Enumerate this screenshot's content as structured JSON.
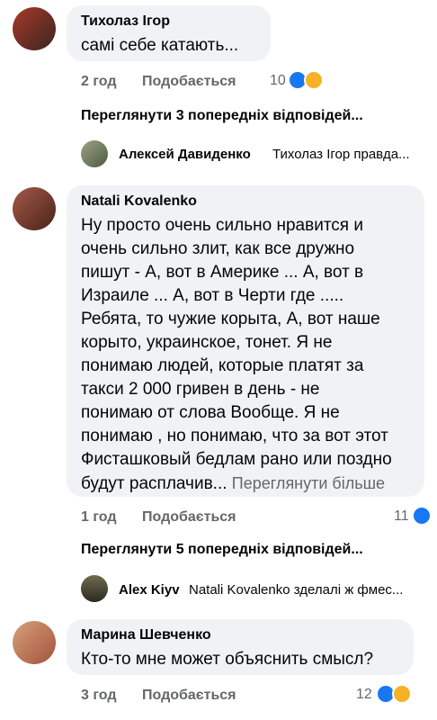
{
  "comments": [
    {
      "author": "Тихолаз Ігор",
      "text": "самі себе катають...",
      "time": "2 год",
      "like_label": "Подобається",
      "reactions": "10"
    },
    {
      "author": "Natali Kovalenko",
      "lines": [
        "Ну просто очень сильно нравится и",
        "очень сильно злит, как все дружно",
        "пишут - А, вот в Америке ... А, вот в",
        "Израиле  ...  А, вот в  Черти где .....",
        "Ребята, то чужие корыта, А, вот наше",
        "корыто, украинское, тонет. Я не",
        "понимаю людей, которые платят за",
        "такси 2 000 гривен в день - не",
        "понимаю от слова Вообще. Я не",
        "понимаю , но понимаю, что за вот этот",
        "Фисташковый бедлам рано или поздно"
      ],
      "last_line": "будут расплачив...",
      "see_more": "Переглянути більше",
      "time": "1 год",
      "like_label": "Подобається",
      "reactions": "11"
    },
    {
      "author": "Марина Шевченко",
      "text": "Кто-то мне может объяснить смысл?",
      "time": "3 год",
      "like_label": "Подобається",
      "reactions": "12"
    }
  ],
  "replies_threads": [
    {
      "view_prev": "Переглянути 3 попередніх відповідей...",
      "reply_author": "Алексей Давиденко",
      "reply_text": "Тихолаз Ігор правда..."
    },
    {
      "view_prev": "Переглянути 5 попередніх відповідей...",
      "reply_author": "Alex Kiyv",
      "reply_text": "Natali Kovalenko зделалі ж фмес..."
    }
  ],
  "colors": {
    "bubble": "#f0f2f5",
    "meta": "#65676b",
    "like_blue": "#1877f2",
    "emoji_yellow": "#f7b125"
  }
}
